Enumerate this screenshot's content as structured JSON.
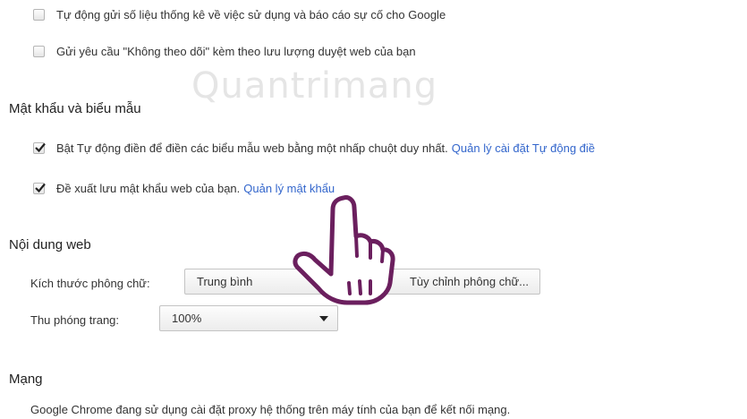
{
  "privacy": {
    "items": [
      {
        "label": "Tự động gửi số liệu thống kê về việc sử dụng và báo cáo sự cố cho Google",
        "checked": false
      },
      {
        "label": "Gửi yêu cầu \"Không theo dõi\" kèm theo lưu lượng duyệt web của bạn",
        "checked": false
      }
    ]
  },
  "watermark": {
    "text": "Quantrimang"
  },
  "passwords": {
    "heading": "Mật khẩu và biểu mẫu",
    "autofill": {
      "label": "Bật Tự động điền để điền các biểu mẫu web bằng một nhấp chuột duy nhất.",
      "link": "Quản lý cài đặt Tự động điề",
      "checked": true
    },
    "save_passwords": {
      "label": "Đề xuất lưu mật khẩu web của bạn.",
      "link": "Quản lý mật khẩu",
      "checked": true
    }
  },
  "web_content": {
    "heading": "Nội dung web",
    "font_size_label": "Kích thước phông chữ:",
    "font_size_value": "Trung bình",
    "customize_fonts_button": "Tùy chỉnh phông chữ...",
    "page_zoom_label": "Thu phóng trang:",
    "page_zoom_value": "100%"
  },
  "network": {
    "heading": "Mạng",
    "description": "Google Chrome đang sử dụng cài đặt proxy hệ thống trên máy tính của bạn để kết nối mạng."
  },
  "colors": {
    "link": "#3366cc",
    "hand_outline": "#6b1f5e"
  }
}
